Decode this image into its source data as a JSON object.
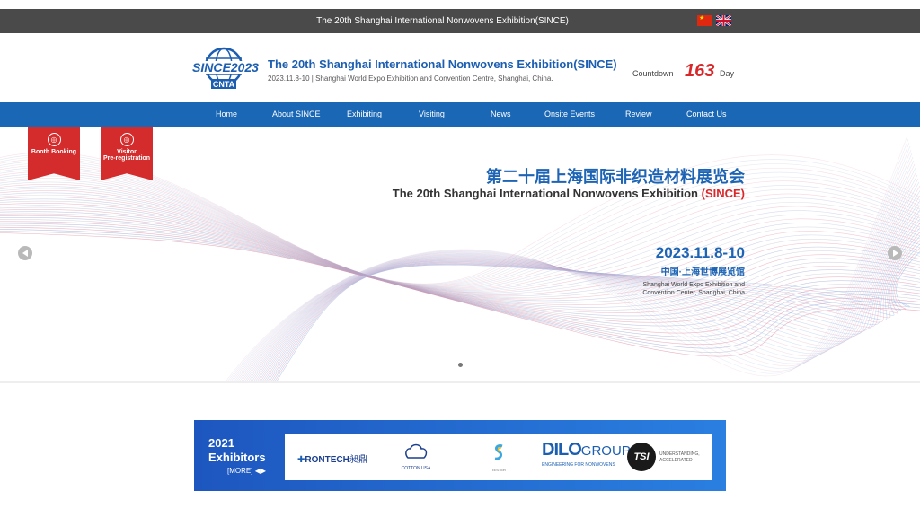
{
  "topbar": {
    "title": "The 20th Shanghai International Nonwovens Exhibition(SINCE)"
  },
  "header": {
    "logo": {
      "top_text": "SINCE2023",
      "bottom_text": "CNTA"
    },
    "title": "The 20th Shanghai International Nonwovens Exhibition(SINCE)",
    "subtitle": "2023.11.8-10 | Shanghai World Expo Exhibition and Convention Centre, Shanghai, China.",
    "countdown_label": "Countdown",
    "countdown_value": "163",
    "countdown_unit": "Day"
  },
  "nav": {
    "items": [
      "Home",
      "About SINCE",
      "Exhibiting",
      "Visiting",
      "News",
      "Onsite Events",
      "Review",
      "Contact Us"
    ]
  },
  "hero": {
    "ribbons": [
      {
        "label": "Booth Booking"
      },
      {
        "label_line1": "Visitor",
        "label_line2": "Pre-registration"
      }
    ],
    "title_cn": "第二十届上海国际非织造材料展览会",
    "title_en": "The 20th Shanghai International Nonwovens Exhibition ",
    "title_en_accent": "(SINCE)",
    "date": "2023.11.8-10",
    "venue_cn": "中国·上海世博展览馆",
    "venue_en": "Shanghai World Expo Exhibition and Convention Center, Shanghai, China"
  },
  "exhibitors": {
    "title_line1": "2021",
    "title_line2": "Exhibitors",
    "more": "[MORE]",
    "logos": {
      "rontech": "RONTECH",
      "rontech_cn": "昶鼎",
      "cotton": "COTTON USA",
      "tester": "TESTER",
      "dilo": "DILO",
      "dilo_group": "GROUP",
      "dilo_tag": "ENGINEERING FOR NONWOVENS",
      "tsi": "TSI",
      "tsi_tag_1": "UNDERSTANDING,",
      "tsi_tag_2": "ACCELERATED"
    }
  },
  "colors": {
    "nav_blue": "#1a67b5",
    "accent_red": "#d8282a",
    "title_blue": "#1c5eb0",
    "topbar": "#4a4a4a"
  }
}
